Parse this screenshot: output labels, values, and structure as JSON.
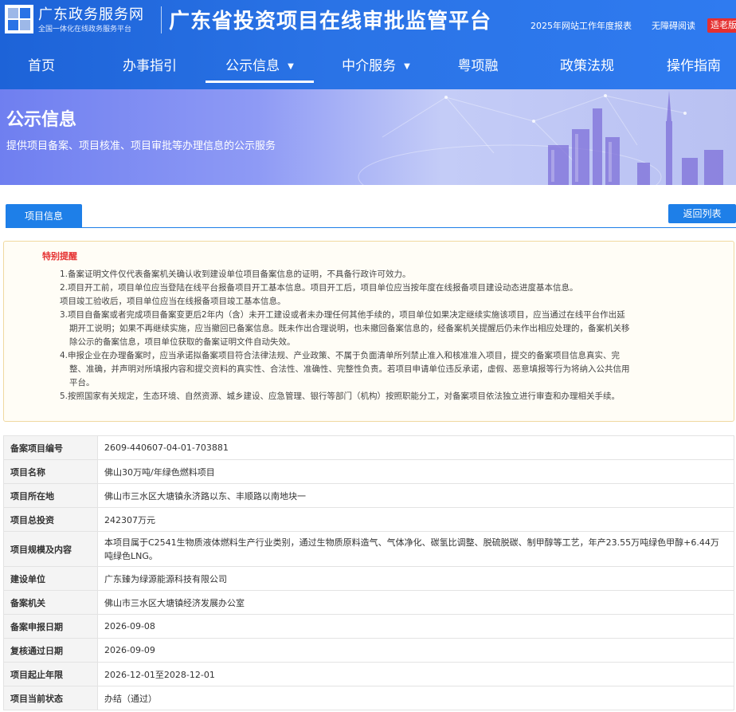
{
  "header": {
    "site_name": "广东政务服务网",
    "site_slogan": "全国一体化在线政务服务平台",
    "platform_title": "广东省投资项目在线审批监管平台",
    "annual_report_link": "2025年网站工作年度报表",
    "accessibility_link": "无障碍阅读",
    "elder_mode_badge": "适老版"
  },
  "nav": {
    "items": [
      {
        "label": "首页"
      },
      {
        "label": "办事指引"
      },
      {
        "label": "公示信息"
      },
      {
        "label": "中介服务"
      },
      {
        "label": "粤项融"
      },
      {
        "label": "政策法规"
      },
      {
        "label": "操作指南"
      }
    ],
    "active_index": 2
  },
  "banner": {
    "title": "公示信息",
    "description": "提供项目备案、项目核准、项目审批等办理信息的公示服务"
  },
  "tabs": {
    "project_info": "项目信息",
    "back_to_list": "返回列表"
  },
  "notice": {
    "title": "特别提醒",
    "items": [
      "1.备案证明文件仅代表备案机关确认收到建设单位项目备案信息的证明，不具备行政许可效力。",
      "2.项目开工前，项目单位应当登陆在线平台报备项目开工基本信息。项目开工后，项目单位应当按年度在线报备项目建设动态进度基本信息。",
      "项目竣工验收后，项目单位应当在线报备项目竣工基本信息。",
      "3.项目自备案或者完成项目备案变更后2年内（含）未开工建设或者未办理任何其他手续的，项目单位如果决定继续实施该项目，应当通过在线平台作出延期开工说明；如果不再继续实施，应当撤回已备案信息。既未作出合理说明，也未撤回备案信息的，经备案机关提醒后仍未作出相应处理的，备案机关移除公示的备案信息，项目单位获取的备案证明文件自动失效。",
      "4.申报企业在办理备案时，应当承诺拟备案项目符合法律法规、产业政策、不属于负面清单所列禁止准入和核准准入项目，提交的备案项目信息真实、完整、准确，并声明对所填报内容和提交资料的真实性、合法性、准确性、完整性负责。若项目申请单位违反承诺，虚假、恶意填报等行为将纳入公共信用平台。",
      "5.按照国家有关规定，生态环境、自然资源、城乡建设、应急管理、银行等部门（机构）按照职能分工，对备案项目依法独立进行审查和办理相关手续。"
    ]
  },
  "project": {
    "rows": [
      {
        "label": "备案项目编号",
        "value": "2609-440607-04-01-703881"
      },
      {
        "label": "项目名称",
        "value": "佛山30万吨/年绿色燃料项目"
      },
      {
        "label": "项目所在地",
        "value": "佛山市三水区大塘镇永济路以东、丰顺路以南地块一"
      },
      {
        "label": "项目总投资",
        "value": "242307万元"
      },
      {
        "label": "项目规模及内容",
        "value": "本项目属于C2541生物质液体燃料生产行业类别，通过生物质原料造气、气体净化、碳氢比调整、脱硫脱碳、制甲醇等工艺，年产23.55万吨绿色甲醇+6.44万吨绿色LNG。"
      },
      {
        "label": "建设单位",
        "value": "广东臻为绿源能源科技有限公司"
      },
      {
        "label": "备案机关",
        "value": "佛山市三水区大塘镇经济发展办公室"
      },
      {
        "label": "备案申报日期",
        "value": "2026-09-08"
      },
      {
        "label": "复核通过日期",
        "value": "2026-09-09"
      },
      {
        "label": "项目起止年限",
        "value": "2026-12-01至2028-12-01"
      },
      {
        "label": "项目当前状态",
        "value": "办结（通过）"
      }
    ]
  },
  "colors": {
    "header_blue": "#2a73e6",
    "button_blue": "#1e7fe8",
    "alert_red": "#e53030"
  }
}
